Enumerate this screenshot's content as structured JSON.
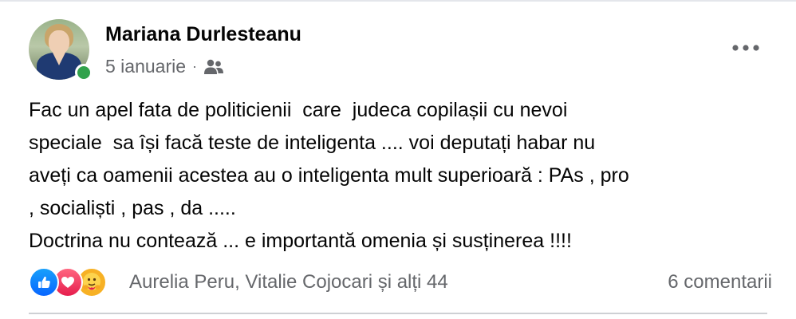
{
  "post": {
    "author": "Mariana Durlesteanu",
    "date": "5 ianuarie",
    "separator": "·",
    "audience_icon": "friends-icon",
    "more_icon": "more-options-icon",
    "text": "Fac un apel fata de politicienii  care  judeca copilașii cu nevoi\nspeciale  sa își facă teste de inteligenta .... voi deputați habar nu\naveți ca oamenii acestea au o inteligenta mult superioară : PAs , pro\n, socialiști , pas , da .....\nDoctrina nu contează ... e importantă omenia și susținerea !!!!"
  },
  "reactions": {
    "icons": [
      "like-reaction-icon",
      "love-reaction-icon",
      "care-reaction-icon"
    ],
    "summary": "Aurelia Peru, Vitalie Cojocari și alți 44",
    "comments": "6 comentarii"
  },
  "colors": {
    "online": "#31a24c",
    "like": "#0866ff",
    "love": "#e61e4d",
    "care": "#f7b125",
    "secondary_text": "#65676b"
  }
}
